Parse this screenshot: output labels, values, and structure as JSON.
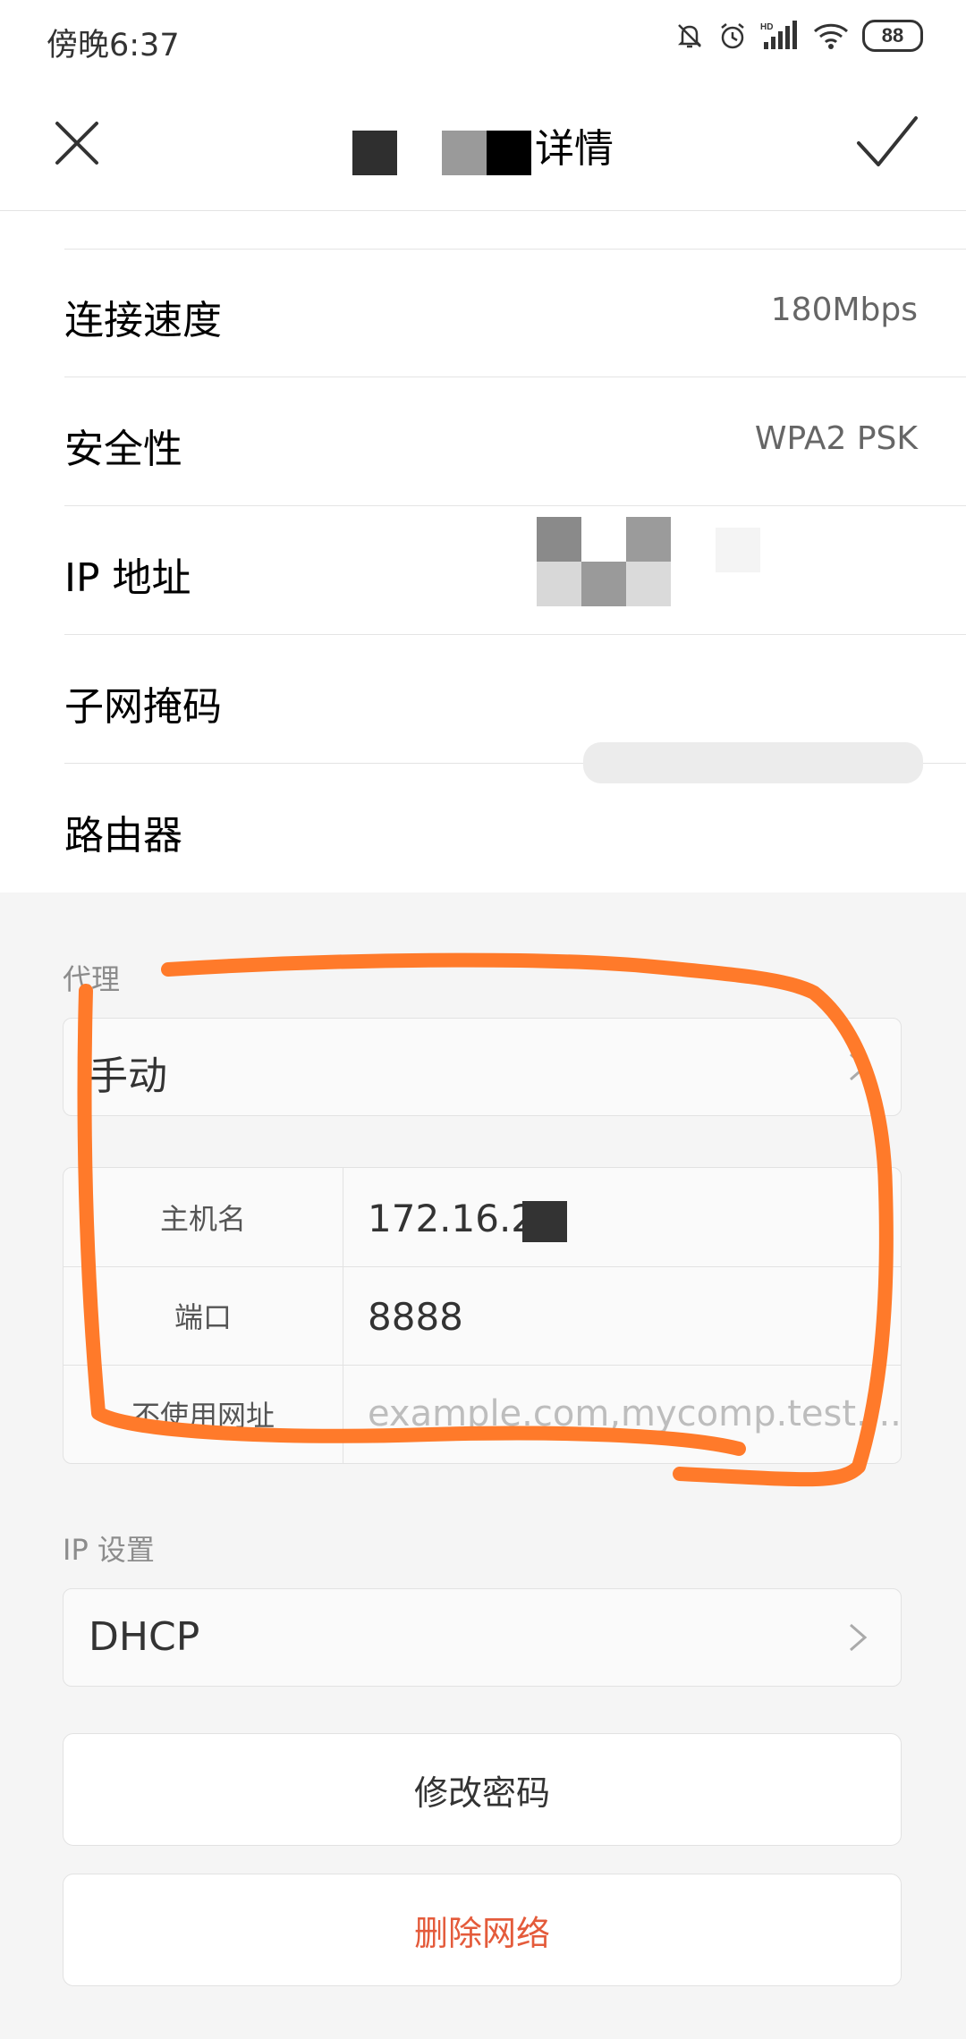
{
  "status_bar": {
    "time": "傍晚6:37",
    "battery": "88",
    "icons": [
      "mute-bell-icon",
      "alarm-icon",
      "hd-signal-icon",
      "wifi-icon",
      "battery-icon"
    ]
  },
  "header": {
    "title_visible": "详情",
    "close_icon": "close-icon",
    "confirm_icon": "check-icon"
  },
  "info": {
    "rows": [
      {
        "label": "连接速度",
        "value": "180Mbps"
      },
      {
        "label": "安全性",
        "value": "WPA2 PSK"
      },
      {
        "label": "IP 地址",
        "value": ""
      },
      {
        "label": "子网掩码",
        "value": ""
      },
      {
        "label": "路由器",
        "value": ""
      }
    ]
  },
  "proxy": {
    "section_label": "代理",
    "mode": "手动",
    "rows": [
      {
        "key": "主机名",
        "value": "172.16.2"
      },
      {
        "key": "端口",
        "value": "8888"
      },
      {
        "key": "不使用网址",
        "placeholder": "example.com,mycomp.test...."
      }
    ]
  },
  "ip_settings": {
    "section_label": "IP 设置",
    "value": "DHCP"
  },
  "actions": {
    "change_password": "修改密码",
    "delete_network": "删除网络"
  },
  "colors": {
    "accent_danger": "#e45b3b",
    "annotation_stroke": "#ff7a2a"
  }
}
